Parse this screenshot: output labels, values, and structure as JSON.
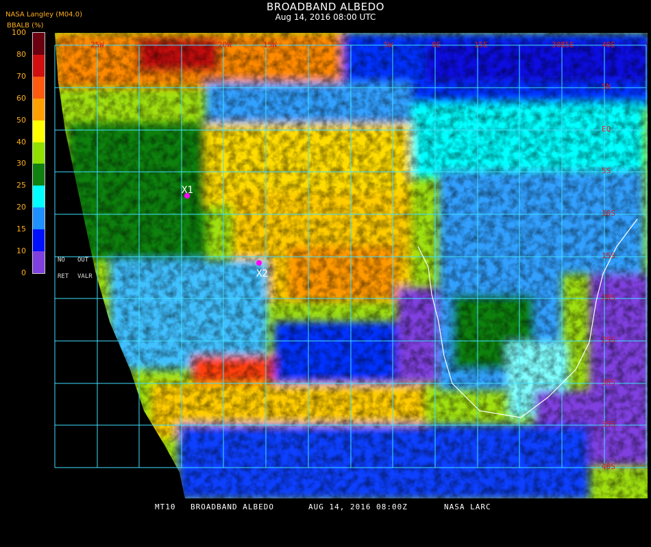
{
  "header": {
    "title": "BROADBAND ALBEDO",
    "subtitle": "Aug 14, 2016 08:00 UTC",
    "product": "NASA Langley (M04.0)"
  },
  "colorbar": {
    "label": "BBALB (%)",
    "ticks": [
      "100",
      "80",
      "70",
      "60",
      "50",
      "40",
      "30",
      "25",
      "20",
      "15",
      "10",
      "0"
    ],
    "segments": [
      {
        "from": 80,
        "to": 100,
        "color": "#6a0010"
      },
      {
        "from": 70,
        "to": 80,
        "color": "#d01010"
      },
      {
        "from": 60,
        "to": 70,
        "color": "#ff5a10"
      },
      {
        "from": 50,
        "to": 60,
        "color": "#ffa000"
      },
      {
        "from": 40,
        "to": 50,
        "color": "#ffff00"
      },
      {
        "from": 30,
        "to": 40,
        "color": "#90e000"
      },
      {
        "from": 25,
        "to": 30,
        "color": "#108010"
      },
      {
        "from": 20,
        "to": 25,
        "color": "#00ffff"
      },
      {
        "from": 15,
        "to": 20,
        "color": "#1e90ff"
      },
      {
        "from": 10,
        "to": 15,
        "color": "#0010ff"
      },
      {
        "from": 0,
        "to": 10,
        "color": "#8040e0"
      }
    ],
    "no_out": [
      "NO",
      "OUT"
    ],
    "ret_valr": [
      "RET",
      "VALR"
    ]
  },
  "map": {
    "lat_labels": [
      "5N",
      "EQ",
      "5S",
      "10S",
      "15S",
      "20S",
      "25S",
      "30S",
      "35S",
      "40S"
    ],
    "lon_labels": [
      "25W",
      "20W",
      "15W",
      "5W",
      "0E",
      "15E",
      "30E",
      "35E",
      "40E"
    ],
    "markers": [
      {
        "label": "X1"
      },
      {
        "label": "X2"
      }
    ]
  },
  "footer": {
    "satellite": "MT10",
    "product": "BROADBAND ALBEDO",
    "datetime": "AUG 14, 2016 08:00Z",
    "source": "NASA LARC"
  }
}
